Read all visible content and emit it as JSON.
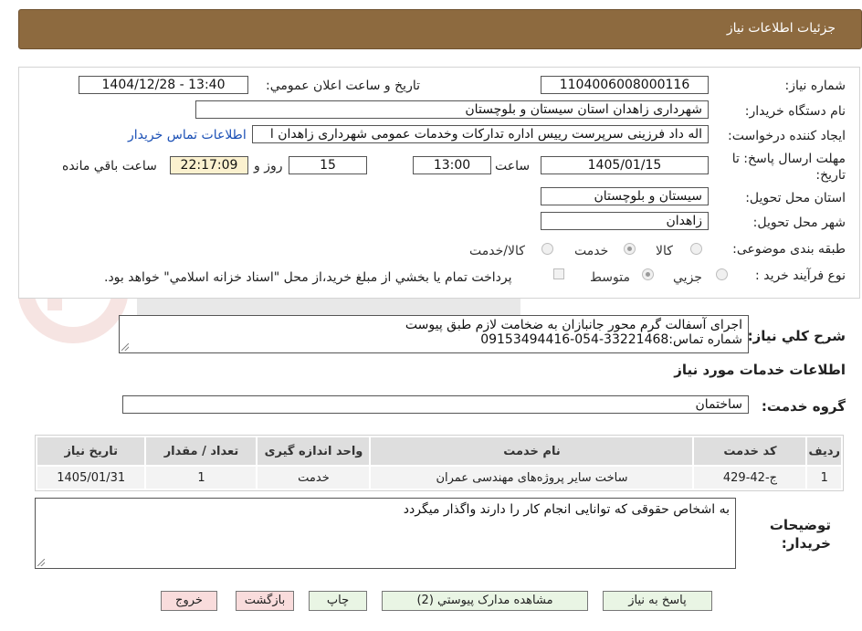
{
  "header": {
    "title": "جزئيات اطلاعات نياز"
  },
  "form": {
    "need_number_label": "شماره نياز:",
    "need_number": "1104006008000116",
    "announce_label": "تاريخ و ساعت اعلان عمومي:",
    "announce_value": "1404/12/28 - 13:40",
    "buyer_org_label": "نام دستگاه خريدار:",
    "buyer_org": "شهرداری زاهدان استان سيستان و بلوچستان",
    "requester_label": "ايجاد کننده درخواست:",
    "requester": "اله داد فرزینی سرپرست رییس اداره تدارکات وخدمات عمومی شهرداری زاهدان ا",
    "buyer_contact_link": "اطلاعات تماس خريدار",
    "deadline_label": "مهلت ارسال پاسخ: تا تاريخ:",
    "deadline_date": "1405/01/15",
    "time_label": "ساعت",
    "deadline_time": "13:00",
    "days": "15",
    "days_label": "روز و",
    "remaining_time": "22:17:09",
    "remaining_label": "ساعت باقي مانده",
    "province_label": "استان محل تحويل:",
    "province": "سيستان و بلوچستان",
    "city_label": "شهر محل تحويل:",
    "city": "زاهدان",
    "category_label": "طبقه بندی موضوعی:",
    "category_options": [
      "کالا",
      "خدمت",
      "کالا/خدمت"
    ],
    "category_selected": "خدمت",
    "process_label": "نوع فرآيند خريد :",
    "process_options": [
      "جزيي",
      "متوسط"
    ],
    "process_selected": "متوسط",
    "payment_note": "پرداخت تمام يا بخشي از مبلغ خريد،از محل \"اسناد خزانه اسلامي\" خواهد بود."
  },
  "description": {
    "label": "شرح کلي نياز:",
    "line1": "اجرای آسفالت گرم محور جانبازان به ضخامت لازم طبق پیوست",
    "line2": "شماره تماس:33221468-054-09153494416"
  },
  "services": {
    "title": "اطلاعات خدمات مورد نياز",
    "group_label": "گروه خدمت:",
    "group_value": "ساختمان",
    "columns": [
      "رديف",
      "کد خدمت",
      "نام خدمت",
      "واحد اندازه گيری",
      "تعداد / مقدار",
      "تاريخ نياز"
    ],
    "rows": [
      [
        "1",
        "ج-42-429",
        "ساخت ساير پروژه‌های مهندسی عمران",
        "خدمت",
        "1",
        "1405/01/31"
      ]
    ]
  },
  "buyer_notes": {
    "label_line1": "توضيحات",
    "label_line2": "خريدار:",
    "text": "به اشخاص حقوقی که توانایی انجام کار را دارند واگذار میگردد"
  },
  "buttons": {
    "reply": "پاسخ به نياز",
    "attachments": "مشاهده مدارک پيوستي (2)",
    "print": "چاپ",
    "back": "بازگشت",
    "exit": "خروج"
  },
  "colors": {
    "header_bg": "#8d6a3f",
    "link": "#1a4fb5",
    "remaining_bg": "#fbf1cf",
    "button_green": "#e9f5e4",
    "button_red": "#f9dcdc"
  }
}
